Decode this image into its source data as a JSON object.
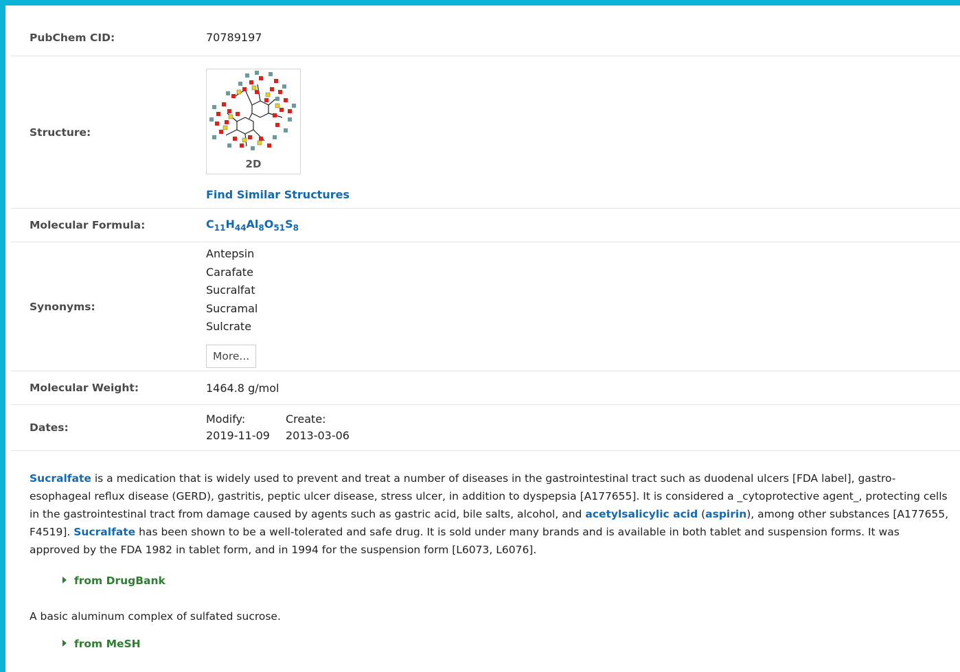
{
  "summary": {
    "cid_label": "PubChem CID:",
    "cid_value": "70789197",
    "structure_label": "Structure:",
    "structure_caption": "2D",
    "find_similar": "Find Similar Structures",
    "formula_label": "Molecular Formula:",
    "formula_parts": [
      {
        "t": "C",
        "s": "11"
      },
      {
        "t": "H",
        "s": "44"
      },
      {
        "t": "Al",
        "s": "8"
      },
      {
        "t": "O",
        "s": "51"
      },
      {
        "t": "S",
        "s": "8"
      }
    ],
    "synonyms_label": "Synonyms:",
    "synonyms": [
      "Antepsin",
      "Carafate",
      "Sucralfat",
      "Sucramal",
      "Sulcrate"
    ],
    "more_button": "More...",
    "mw_label": "Molecular Weight:",
    "mw_value": "1464.8 g/mol",
    "dates_label": "Dates:",
    "modify_label": "Modify:",
    "create_label": "Create:",
    "modify_date": "2019-11-09",
    "create_date": "2013-03-06"
  },
  "description": {
    "link_sucralfate": "Sucralfate",
    "text1": " is a medication that is widely used to prevent and treat a number of diseases in the gastrointestinal tract such as duodenal ulcers [FDA label], gastro-esophageal reflux disease (GERD), gastritis, peptic ulcer disease, stress ulcer, in addition to dyspepsia [A177655]. It is considered a _cytoprotective agent_, protecting cells in the gastrointestinal tract from damage caused by agents such as gastric acid, bile salts, alcohol, and ",
    "link_acetylsalicylic": "acetylsalicylic acid",
    "paren_open": " (",
    "link_aspirin": "aspirin",
    "text2": "), among other substances [A177655, F4519]. ",
    "link_sucralfate2": "Sucralfate",
    "text3": " has been shown to be a well-tolerated and safe drug. It is sold under many brands and is available in both tablet and suspension forms. It was approved by the FDA 1982 in tablet form, and in 1994 for the suspension form [L6073, L6076].",
    "source1": "from DrugBank",
    "text_mesh": "A basic aluminum complex of sulfated sucrose.",
    "source2": "from MeSH"
  },
  "colors": {
    "accent_border": "#0cb4d8",
    "link": "#1569b3",
    "source_green": "#2e7d32"
  }
}
